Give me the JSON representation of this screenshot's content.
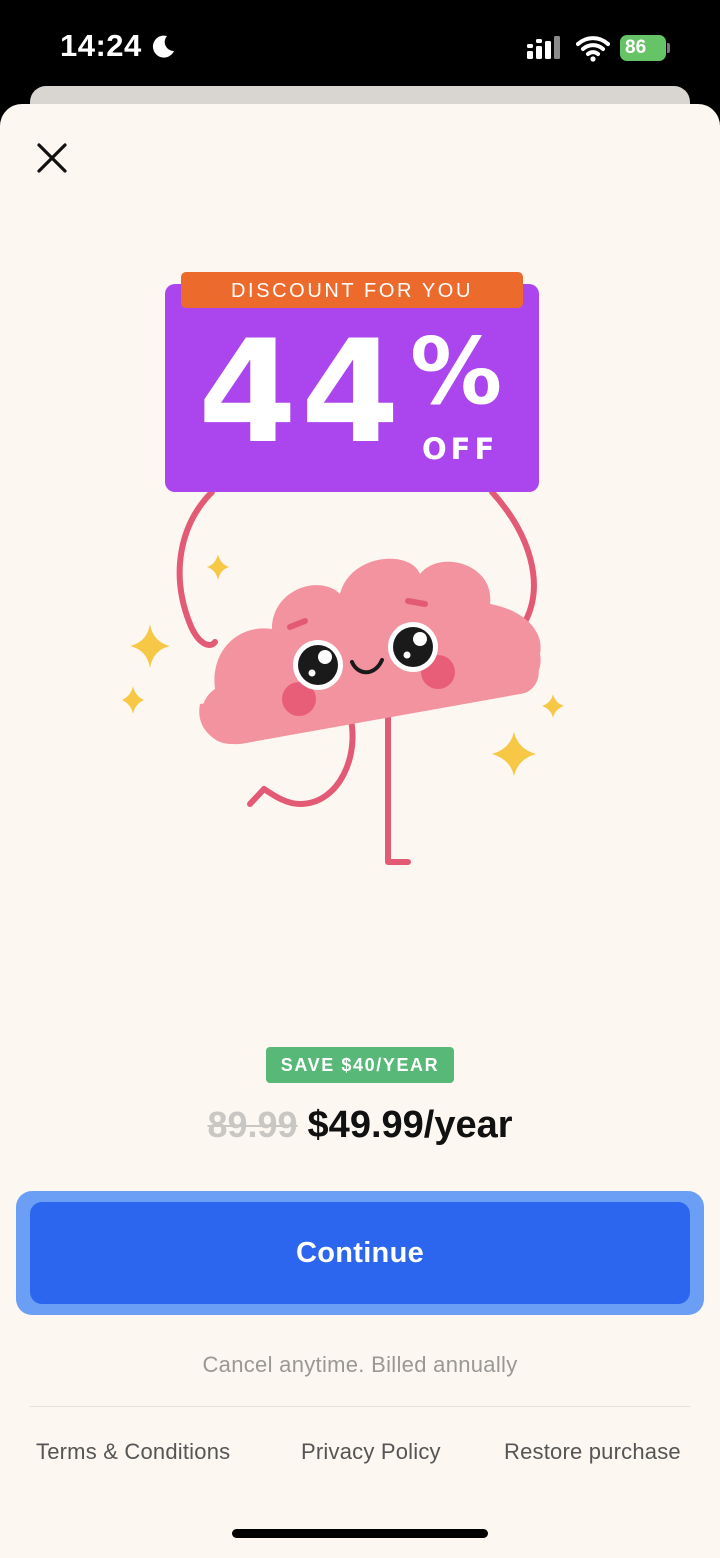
{
  "status_bar": {
    "time": "14:24",
    "battery": "86"
  },
  "promo": {
    "banner": "DISCOUNT FOR YOU",
    "number": "44",
    "percent": "%",
    "off": "OFF"
  },
  "pricing": {
    "save_badge": "SAVE $40/YEAR",
    "old_price": "89.99",
    "new_price": "$49.99/year"
  },
  "cta": {
    "label": "Continue"
  },
  "billing_note": "Cancel anytime. Billed annually",
  "footer": {
    "terms": "Terms & Conditions",
    "privacy": "Privacy Policy",
    "restore": "Restore purchase"
  },
  "colors": {
    "background": "#fcf7f1",
    "sign_purple": "#ab46ee",
    "banner_orange": "#ec6a2c",
    "save_green": "#58b877",
    "cta_blue": "#2c66ee",
    "mascot_pink": "#f2939f",
    "sparkle_yellow": "#f7c746"
  },
  "icons": [
    "moon-icon",
    "signal-icon",
    "wifi-icon",
    "battery-icon",
    "close-icon",
    "sparkle-icon"
  ]
}
